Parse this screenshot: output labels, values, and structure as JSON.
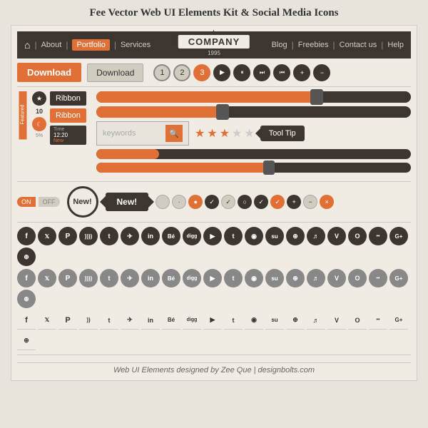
{
  "title": "Fee Vector Web UI Elements Kit & Social Media Icons",
  "nav": {
    "home_icon": "⌂",
    "items": [
      "About",
      "Portfolio",
      "Services",
      "Blog",
      "Freebies",
      "Contact us",
      "Help"
    ],
    "active": "Portfolio",
    "logo": "COMPANY",
    "year": "1995"
  },
  "buttons": {
    "download_orange": "Download",
    "download_gray": "Download"
  },
  "pagination": {
    "pages": [
      "1",
      "2",
      "3"
    ],
    "active": "3",
    "controls": [
      "▶",
      "⏸",
      "⏭",
      "⏮",
      "+",
      "−"
    ]
  },
  "sliders": {
    "keywords_placeholder": "keywords"
  },
  "ribbons": {
    "label1": "Ribbon",
    "label2": "Ribbon",
    "featured": "Featured",
    "time": "12:20",
    "new_label": "New!"
  },
  "tooltip": {
    "label": "Tool Tip"
  },
  "toggle": {
    "on": "ON",
    "off": "OFF"
  },
  "footer": "Web UI Elements designed by Zee Que | designbolts.com",
  "social_icons": [
    "f",
    "𝕏",
    "℗",
    "♪",
    "t",
    "✈",
    "in",
    "Bé",
    "digg",
    "▶",
    "t",
    "◉",
    "su",
    "⊕",
    "♬",
    "V",
    "O",
    "••",
    "G+",
    "⊕",
    "f",
    "𝕏",
    "℗",
    "♪",
    "t",
    "✈",
    "in",
    "Bé",
    "digg",
    "▶",
    "t",
    "◉",
    "su",
    "⊕",
    "♬",
    "V",
    "O",
    "••",
    "G+",
    "⊕",
    "f",
    "𝕏",
    "℗",
    "♪",
    "t",
    "✈",
    "in",
    "Bé",
    "digg",
    "▶",
    "t",
    "◉",
    "su",
    "⊕",
    "♬",
    "V",
    "O",
    "••",
    "G+",
    "⊕"
  ]
}
